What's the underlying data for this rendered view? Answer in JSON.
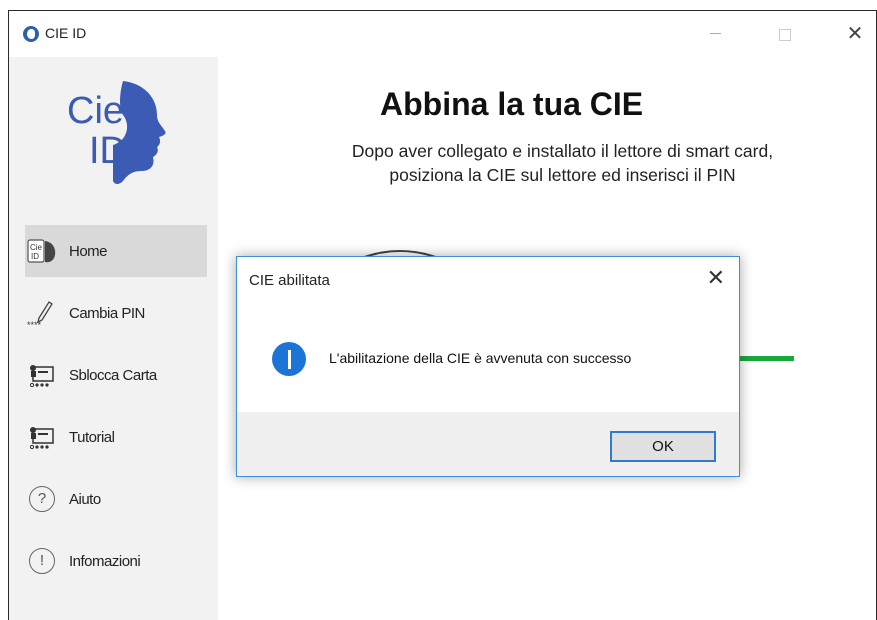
{
  "window": {
    "title": "CIE ID",
    "controls": {
      "minimize": "minimize-icon",
      "maximize": "maximize-icon",
      "close": "close-icon"
    }
  },
  "logo": {
    "line1": "Cie",
    "line2": "ID",
    "color": "#3b5bb5"
  },
  "sidebar": {
    "items": [
      {
        "label": "Home",
        "icon": "cie-card-icon",
        "active": true
      },
      {
        "label": "Cambia PIN",
        "icon": "pencil-pin-icon"
      },
      {
        "label": "Sblocca Carta",
        "icon": "card-unlock-icon"
      },
      {
        "label": "Tutorial",
        "icon": "card-tutorial-icon"
      },
      {
        "label": "Aiuto",
        "icon": "help-icon",
        "glyph": "?"
      },
      {
        "label": "Infomazioni",
        "icon": "info-circle-icon",
        "glyph": "!"
      }
    ]
  },
  "main": {
    "title": "Abbina la tua CIE",
    "subtitle_line1": "Dopo aver collegato e installato il lettore di smart card,",
    "subtitle_line2": "posiziona la CIE sul lettore ed inserisci il PIN"
  },
  "dialog": {
    "title": "CIE abilitata",
    "message": "L'abilitazione della CIE è avvenuta con successo",
    "ok_label": "OK",
    "icon": "info-icon"
  },
  "colors": {
    "accent": "#2e7bd1",
    "info": "#1c74d6",
    "success": "#19a83c",
    "sidebar_bg": "#f2f2f2"
  }
}
